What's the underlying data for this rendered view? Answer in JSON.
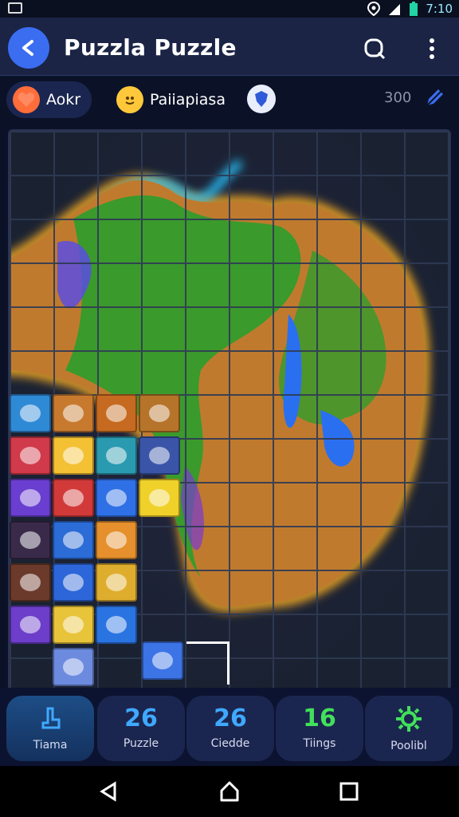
{
  "status_bar": {
    "time": "7:10",
    "icons": [
      "notification-icon",
      "location-icon",
      "signal-icon",
      "battery-icon"
    ]
  },
  "app_bar": {
    "title": "Puzzla Puzzle",
    "icons": [
      "back-icon",
      "search-icon",
      "more-vert-icon"
    ],
    "accent": "#3a6df0"
  },
  "info_bar": {
    "player1": {
      "name": "Aokr",
      "icon": "avatar-heart-icon"
    },
    "player2": {
      "name": "Paiiapiasa",
      "icon": "avatar-face-icon"
    },
    "badge_icon": "shield-icon",
    "score": "300",
    "edit_icon": "pencil-icon"
  },
  "board": {
    "grid_color": "#2f3a54",
    "glow_colors": [
      "#ffb020",
      "#25c6ff"
    ],
    "tray_tiles": [
      "blue-blob-icon",
      "yellow-bird-icon",
      "orange-creature-icon",
      "yellow-star-animal-icon",
      "pink-cat-icon",
      "yellow-bear-icon",
      "teal-creature-icon",
      "blue-creature-icon",
      "monkey-icon",
      "white-bird-icon",
      "blue-star-icon",
      "blue-gift-icon",
      "black-creature-icon",
      "blue-cat-icon",
      "rocket-icon",
      "white-dog-icon",
      "blue-heart-icon",
      "unicorn-icon",
      "purple-tile-icon",
      "white-bird-icon",
      "blue-square-icon",
      "white-ghost-icon",
      "blue-bird-icon",
      "sun-icon",
      "orange-bag-icon"
    ]
  },
  "tabs": [
    {
      "value": "",
      "label": "Tiama",
      "icon": "hand-icon",
      "active": true
    },
    {
      "value": "26",
      "label": "Puzzle",
      "active": false
    },
    {
      "value": "26",
      "label": "Ciedde",
      "active": false
    },
    {
      "value": "16",
      "label": "Tiings",
      "active": false
    },
    {
      "value": "",
      "label": "Poolibl",
      "icon": "gear-icon",
      "active": false
    }
  ],
  "nav_bar": {
    "icons": [
      "back-triangle-icon",
      "home-circle-icon",
      "recents-square-icon"
    ]
  }
}
